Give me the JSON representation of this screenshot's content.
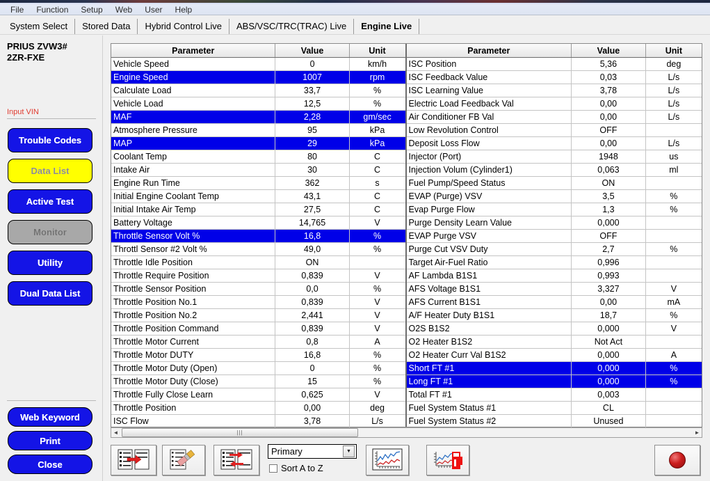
{
  "menu": {
    "items": [
      "File",
      "Function",
      "Setup",
      "Web",
      "User",
      "Help"
    ]
  },
  "tabs": [
    {
      "label": "System Select",
      "active": false
    },
    {
      "label": "Stored Data",
      "active": false
    },
    {
      "label": "Hybrid Control Live",
      "active": false
    },
    {
      "label": "ABS/VSC/TRC(TRAC) Live",
      "active": false
    },
    {
      "label": "Engine Live",
      "active": true
    }
  ],
  "sidebar": {
    "vehicle_line1": "PRIUS ZVW3#",
    "vehicle_line2": "2ZR-FXE",
    "input_vin": "Input VIN",
    "buttons": [
      {
        "label": "Trouble Codes",
        "style": "blue"
      },
      {
        "label": "Data List",
        "style": "yellow"
      },
      {
        "label": "Active Test",
        "style": "blue"
      },
      {
        "label": "Monitor",
        "style": "gray"
      },
      {
        "label": "Utility",
        "style": "blue"
      },
      {
        "label": "Dual Data List",
        "style": "blue"
      }
    ],
    "footer_buttons": [
      {
        "label": "Web Keyword"
      },
      {
        "label": "Print"
      },
      {
        "label": "Close"
      }
    ]
  },
  "grid": {
    "headers": {
      "parameter": "Parameter",
      "value": "Value",
      "unit": "Unit"
    },
    "left_rows": [
      {
        "parameter": "Vehicle Speed",
        "value": "0",
        "unit": "km/h",
        "highlight": false
      },
      {
        "parameter": "Engine Speed",
        "value": "1007",
        "unit": "rpm",
        "highlight": true
      },
      {
        "parameter": "Calculate Load",
        "value": "33,7",
        "unit": "%",
        "highlight": false
      },
      {
        "parameter": "Vehicle Load",
        "value": "12,5",
        "unit": "%",
        "highlight": false
      },
      {
        "parameter": "MAF",
        "value": "2,28",
        "unit": "gm/sec",
        "highlight": true
      },
      {
        "parameter": "Atmosphere Pressure",
        "value": "95",
        "unit": "kPa",
        "highlight": false
      },
      {
        "parameter": "MAP",
        "value": "29",
        "unit": "kPa",
        "highlight": true
      },
      {
        "parameter": "Coolant Temp",
        "value": "80",
        "unit": "C",
        "highlight": false
      },
      {
        "parameter": "Intake Air",
        "value": "30",
        "unit": "C",
        "highlight": false
      },
      {
        "parameter": "Engine Run Time",
        "value": "362",
        "unit": "s",
        "highlight": false
      },
      {
        "parameter": "Initial Engine Coolant Temp",
        "value": "43,1",
        "unit": "C",
        "highlight": false
      },
      {
        "parameter": "Initial Intake Air Temp",
        "value": "27,5",
        "unit": "C",
        "highlight": false
      },
      {
        "parameter": "Battery Voltage",
        "value": "14,765",
        "unit": "V",
        "highlight": false
      },
      {
        "parameter": "Throttle Sensor Volt %",
        "value": "16,8",
        "unit": "%",
        "highlight": true
      },
      {
        "parameter": "Throttl Sensor #2 Volt %",
        "value": "49,0",
        "unit": "%",
        "highlight": false
      },
      {
        "parameter": "Throttle Idle Position",
        "value": "ON",
        "unit": "",
        "highlight": false
      },
      {
        "parameter": "Throttle Require Position",
        "value": "0,839",
        "unit": "V",
        "highlight": false
      },
      {
        "parameter": "Throttle Sensor Position",
        "value": "0,0",
        "unit": "%",
        "highlight": false
      },
      {
        "parameter": "Throttle Position No.1",
        "value": "0,839",
        "unit": "V",
        "highlight": false
      },
      {
        "parameter": "Throttle Position No.2",
        "value": "2,441",
        "unit": "V",
        "highlight": false
      },
      {
        "parameter": "Throttle Position Command",
        "value": "0,839",
        "unit": "V",
        "highlight": false
      },
      {
        "parameter": "Throttle Motor Current",
        "value": "0,8",
        "unit": "A",
        "highlight": false
      },
      {
        "parameter": "Throttle Motor DUTY",
        "value": "16,8",
        "unit": "%",
        "highlight": false
      },
      {
        "parameter": "Throttle Motor Duty (Open)",
        "value": "0",
        "unit": "%",
        "highlight": false
      },
      {
        "parameter": "Throttle Motor Duty (Close)",
        "value": "15",
        "unit": "%",
        "highlight": false
      },
      {
        "parameter": "Throttle Fully Close Learn",
        "value": "0,625",
        "unit": "V",
        "highlight": false
      },
      {
        "parameter": "Throttle Position",
        "value": "0,00",
        "unit": "deg",
        "highlight": false
      },
      {
        "parameter": "ISC Flow",
        "value": "3,78",
        "unit": "L/s",
        "highlight": false
      }
    ],
    "right_rows": [
      {
        "parameter": "ISC Position",
        "value": "5,36",
        "unit": "deg",
        "highlight": false
      },
      {
        "parameter": "ISC Feedback Value",
        "value": "0,03",
        "unit": "L/s",
        "highlight": false
      },
      {
        "parameter": "ISC Learning Value",
        "value": "3,78",
        "unit": "L/s",
        "highlight": false
      },
      {
        "parameter": "Electric Load Feedback Val",
        "value": "0,00",
        "unit": "L/s",
        "highlight": false
      },
      {
        "parameter": "Air Conditioner FB Val",
        "value": "0,00",
        "unit": "L/s",
        "highlight": false
      },
      {
        "parameter": "Low Revolution Control",
        "value": "OFF",
        "unit": "",
        "highlight": false
      },
      {
        "parameter": "Deposit Loss Flow",
        "value": "0,00",
        "unit": "L/s",
        "highlight": false
      },
      {
        "parameter": "Injector (Port)",
        "value": "1948",
        "unit": "us",
        "highlight": false
      },
      {
        "parameter": "Injection Volum (Cylinder1)",
        "value": "0,063",
        "unit": "ml",
        "highlight": false
      },
      {
        "parameter": "Fuel Pump/Speed Status",
        "value": "ON",
        "unit": "",
        "highlight": false
      },
      {
        "parameter": "EVAP (Purge) VSV",
        "value": "3,5",
        "unit": "%",
        "highlight": false
      },
      {
        "parameter": "Evap Purge Flow",
        "value": "1,3",
        "unit": "%",
        "highlight": false
      },
      {
        "parameter": "Purge Density Learn Value",
        "value": "0,000",
        "unit": "",
        "highlight": false
      },
      {
        "parameter": "EVAP Purge VSV",
        "value": "OFF",
        "unit": "",
        "highlight": false
      },
      {
        "parameter": "Purge Cut VSV Duty",
        "value": "2,7",
        "unit": "%",
        "highlight": false
      },
      {
        "parameter": "Target Air-Fuel Ratio",
        "value": "0,996",
        "unit": "",
        "highlight": false
      },
      {
        "parameter": "AF Lambda B1S1",
        "value": "0,993",
        "unit": "",
        "highlight": false
      },
      {
        "parameter": "AFS Voltage B1S1",
        "value": "3,327",
        "unit": "V",
        "highlight": false
      },
      {
        "parameter": "AFS Current B1S1",
        "value": "0,00",
        "unit": "mA",
        "highlight": false
      },
      {
        "parameter": "A/F Heater Duty B1S1",
        "value": "18,7",
        "unit": "%",
        "highlight": false
      },
      {
        "parameter": "O2S B1S2",
        "value": "0,000",
        "unit": "V",
        "highlight": false
      },
      {
        "parameter": "O2 Heater B1S2",
        "value": "Not Act",
        "unit": "",
        "highlight": false
      },
      {
        "parameter": "O2 Heater Curr Val B1S2",
        "value": "0,000",
        "unit": "A",
        "highlight": false
      },
      {
        "parameter": "Short FT #1",
        "value": "0,000",
        "unit": "%",
        "highlight": true
      },
      {
        "parameter": "Long FT #1",
        "value": "0,000",
        "unit": "%",
        "highlight": true
      },
      {
        "parameter": "Total FT #1",
        "value": "0,003",
        "unit": "",
        "highlight": false
      },
      {
        "parameter": "Fuel System Status #1",
        "value": "CL",
        "unit": "",
        "highlight": false
      },
      {
        "parameter": "Fuel System Status #2",
        "value": "Unused",
        "unit": "",
        "highlight": false
      }
    ]
  },
  "scrollbar": {
    "left_arrow": "◄",
    "right_arrow": "►",
    "grip": "|||"
  },
  "toolbar": {
    "select_all_icon": "select-all-icon",
    "clear_icon": "eraser-icon",
    "swap_icon": "swap-icon",
    "dropdown_value": "Primary",
    "dropdown_arrow": "▼",
    "sort_label": "Sort A to Z",
    "sort_checked": false,
    "graph_icon": "line-graph-icon",
    "fuel_graph_icon": "fuel-graph-icon",
    "record_icon": "record-lamp-icon"
  },
  "colors": {
    "highlight_bg": "#0000e8",
    "highlight_fg": "#ffffff",
    "button_blue": "#1414e6",
    "button_yellow": "#ffff00",
    "button_gray": "#a8a8a8",
    "vin_red": "#e03a2f",
    "record_red": "#cc1e1e"
  }
}
